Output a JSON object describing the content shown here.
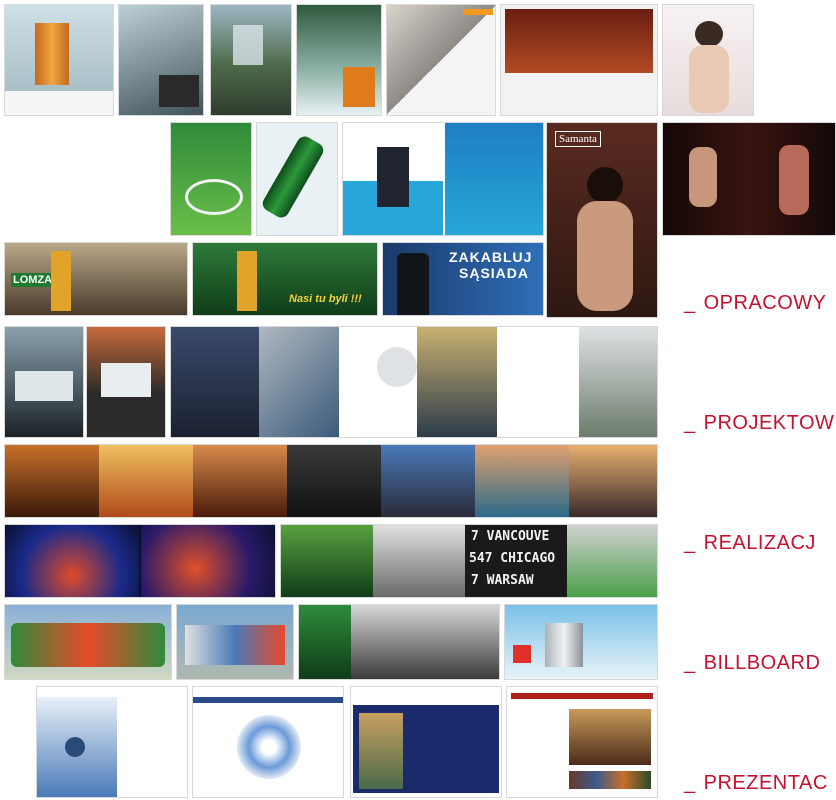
{
  "nav": {
    "items": [
      {
        "dash": "_",
        "label": "OPRACOWY"
      },
      {
        "dash": "_",
        "label": "PROJEKTOW"
      },
      {
        "dash": "_",
        "label": "REALIZACJ"
      },
      {
        "dash": "_",
        "label": "BILLBOARD"
      },
      {
        "dash": "_",
        "label": "PREZENTAC"
      }
    ]
  },
  "thumbnails": {
    "samanta_tag": "Samanta",
    "lomza_brand": "LOMZA",
    "zakabluj_line1": "ZAKABLUJ",
    "zakabluj_line2": "SĄSIADA",
    "billboard_line1": "7 VANCOUVE",
    "billboard_line2": "547 CHICAGO",
    "billboard_line3": "7 WARSAW",
    "beer_slogan": "Nasi tu byli !!!"
  },
  "colors": {
    "accent": "#c8102e",
    "lomza_green": "#1f7a2f",
    "dark": "#1b1b1b"
  }
}
